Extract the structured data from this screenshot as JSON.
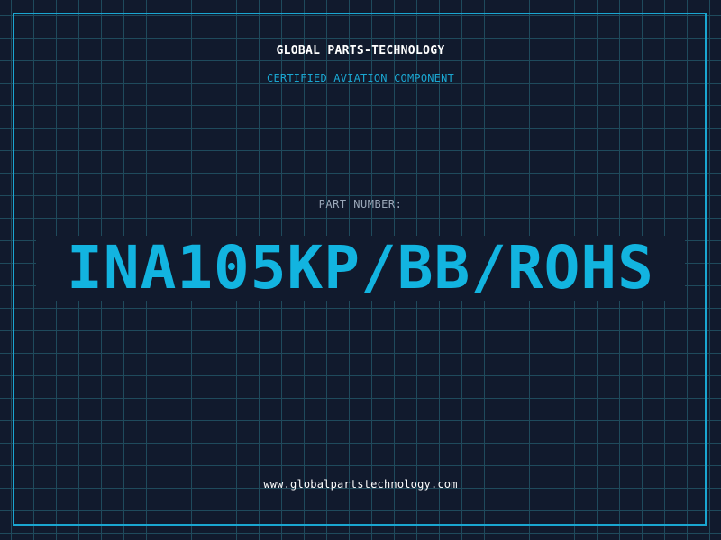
{
  "header": {
    "company_name": "GLOBAL PARTS-TECHNOLOGY",
    "tagline": "CERTIFIED AVIATION COMPONENT"
  },
  "part": {
    "label": "PART NUMBER:",
    "number": "INA105KP/BB/ROHS"
  },
  "footer": {
    "website": "www.globalpartstechnology.com"
  },
  "colors": {
    "background": "#111a2d",
    "grid": "#1f4a5c",
    "accent": "#1aa6d1",
    "part_number": "#12b4e0",
    "text_primary": "#ffffff",
    "text_muted": "#9aa7b8"
  }
}
